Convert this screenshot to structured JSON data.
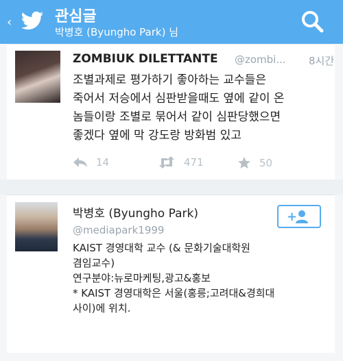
{
  "header": {
    "title": "관심글",
    "subtitle": "박병호 (Byungho Park) 님",
    "back_glyph": "‹",
    "icons": [
      "back-chevron-icon",
      "twitter-bird-icon",
      "search-icon"
    ],
    "accent_color": "#55acee"
  },
  "tweet": {
    "name": "ZOMBIUK DILETTANTE",
    "handle": "@zombi...",
    "time": "8시간",
    "lines": [
      "조별과제로 평가하기 좋아하는 교수들은",
      "죽어서 저승에서 심판받을때도 옆에 같이 온",
      "놈들이랑 조별로 묶어서 같이 심판당했으면",
      "좋겠다 옆에 막 강도랑 방화범 있고"
    ],
    "replies": "14",
    "retweets": "471",
    "favorites": "50"
  },
  "profile": {
    "name": "박병호 (Byungho Park)",
    "handle": "@mediapark1999",
    "bio_lines": [
      "KAIST 경영대학 교수 (& 문화기술대학원",
      "겸임교수)",
      "연구분야:뉴로마케팅,광고&홍보",
      "* KAIST 경영대학은 서울(홍릉;고려대&경희대",
      "사이)에 위치."
    ],
    "follow_icon": "add-person-icon"
  }
}
